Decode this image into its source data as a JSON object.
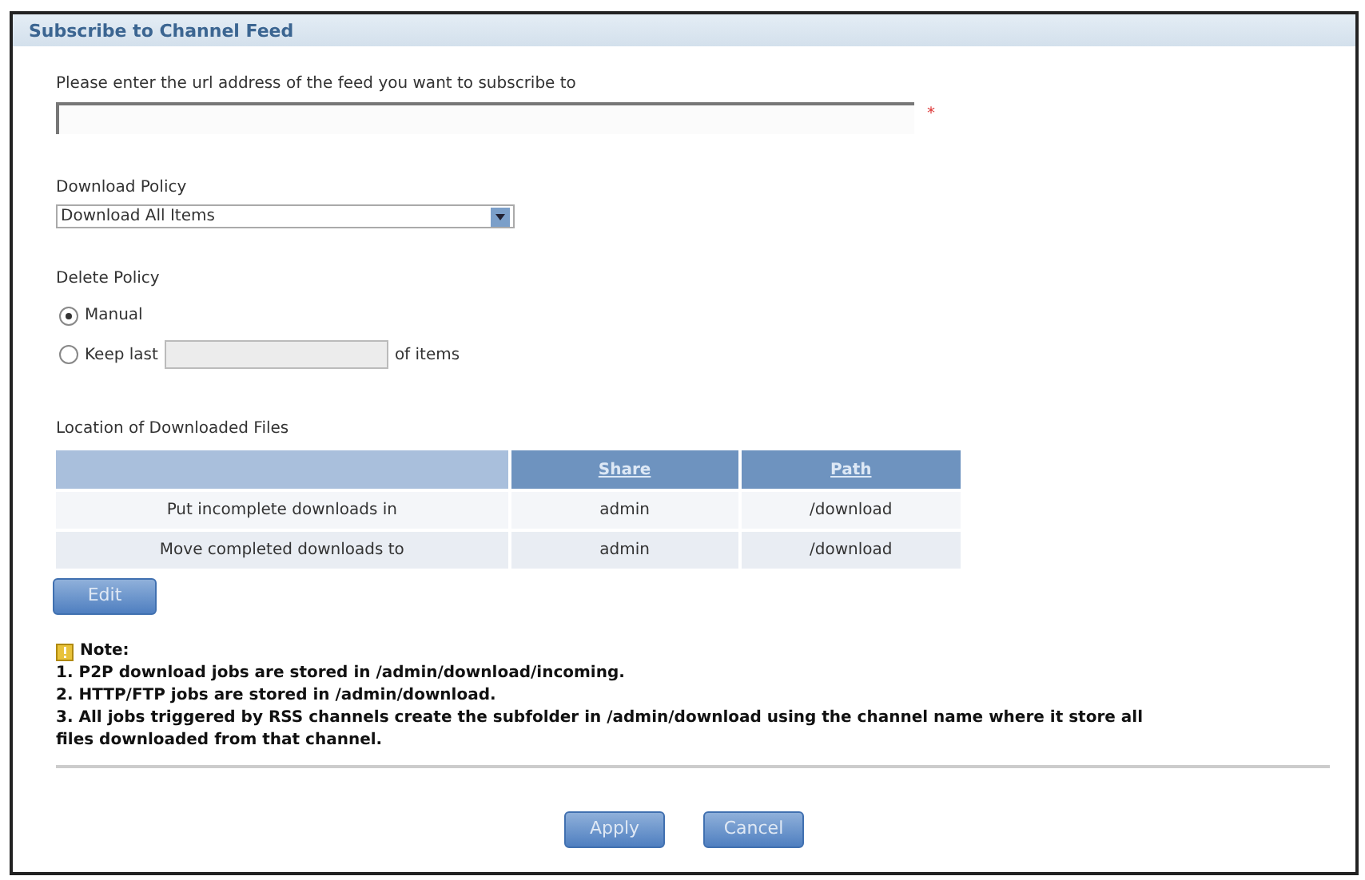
{
  "panel": {
    "title": "Subscribe to Channel Feed"
  },
  "url_field": {
    "label": "Please enter the url address of the feed you want to subscribe to",
    "required_mark": "*"
  },
  "download_policy": {
    "label": "Download Policy",
    "value": "Download All Items"
  },
  "delete_policy": {
    "label": "Delete Policy",
    "options": [
      {
        "kind": "plain",
        "label": "Manual",
        "selected": true
      },
      {
        "kind": "count",
        "label": "Keep last",
        "suffix": "of items",
        "selected": false
      }
    ]
  },
  "locations": {
    "label": "Location of Downloaded Files",
    "columns": [
      "",
      "Share",
      "Path"
    ],
    "rows": [
      [
        "Put incomplete downloads in",
        "admin",
        "/download"
      ],
      [
        "Move completed downloads to",
        "admin",
        "/download"
      ]
    ],
    "edit_button": "Edit"
  },
  "note": {
    "title": "Note:",
    "lines": [
      "1. P2P download jobs are stored in /admin/download/incoming.",
      "2. HTTP/FTP jobs are stored in /admin/download.",
      "3. All jobs triggered by RSS channels create the subfolder in /admin/download using the channel name where it store all files downloaded from that channel."
    ]
  },
  "buttons": [
    "Apply",
    "Cancel"
  ]
}
